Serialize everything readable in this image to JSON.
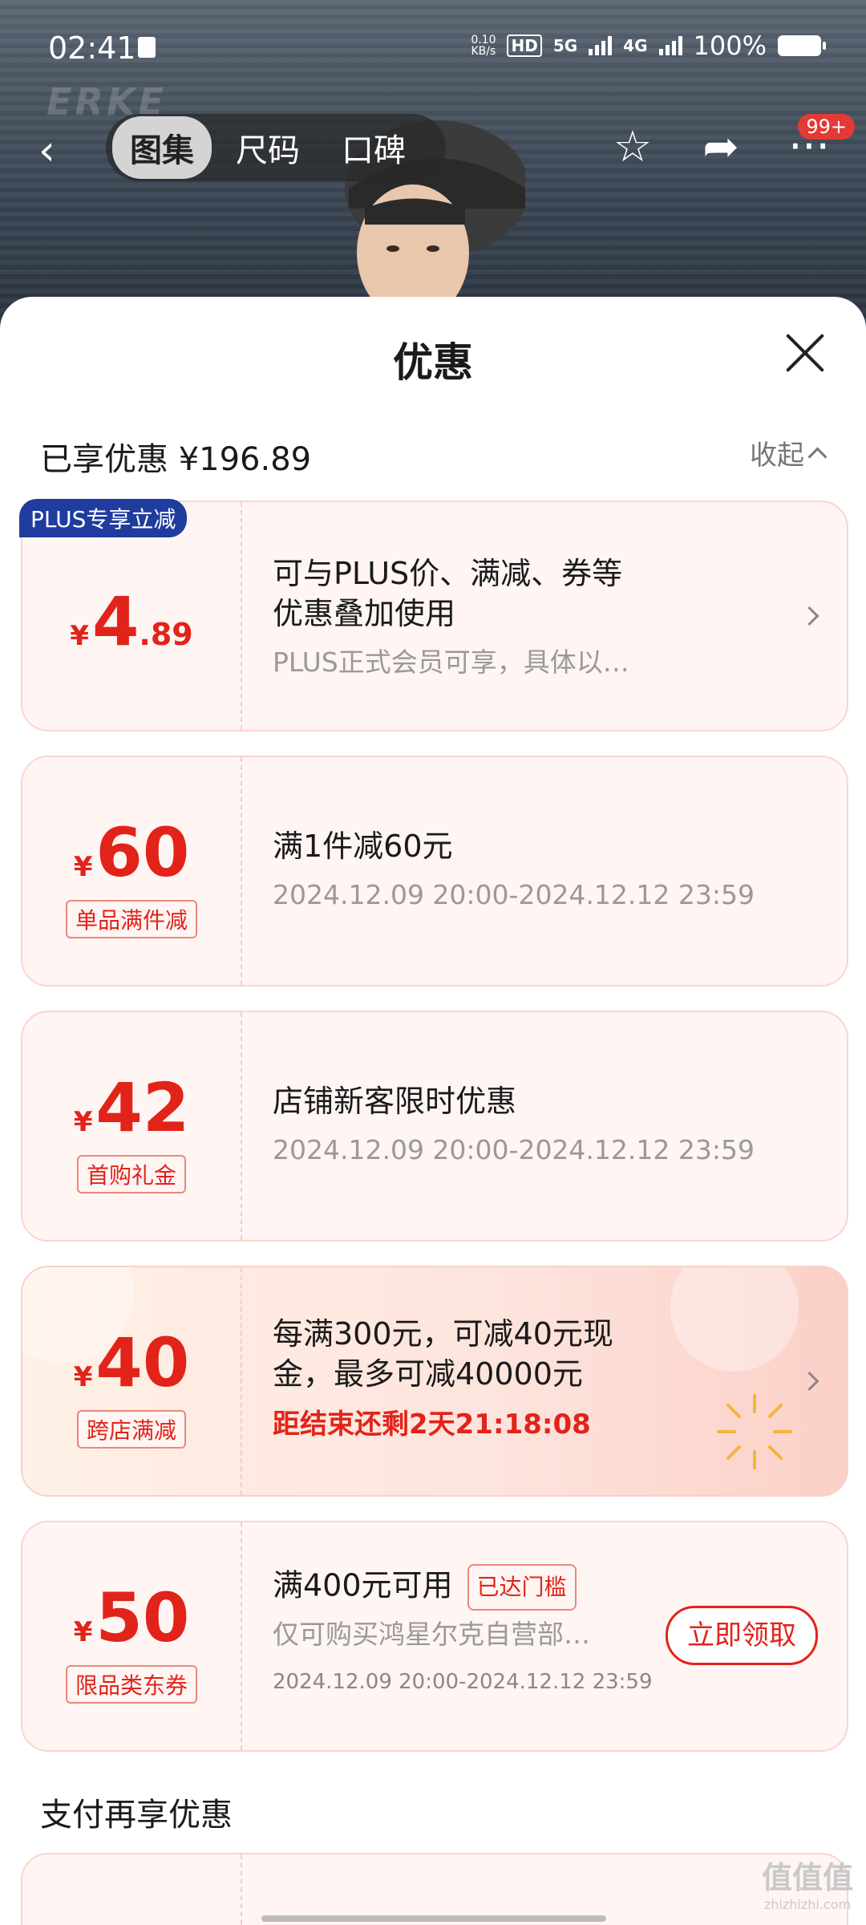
{
  "status": {
    "time": "02:41",
    "net_speed_top": "0.10",
    "net_speed_bottom": "KB/s",
    "hd": "HD",
    "sig1": "5G",
    "sig2": "4G",
    "battery": "100%"
  },
  "hero": {
    "brand": "ERKE"
  },
  "nav": {
    "back": "‹",
    "tabs": [
      "图集",
      "尺码",
      "口碑"
    ],
    "star": "☆",
    "share": "➦",
    "more": "···",
    "badge": "99+"
  },
  "sheet": {
    "title": "优惠",
    "summary": "已享优惠 ¥196.89",
    "collapse": "收起"
  },
  "cards": [
    {
      "badge": "PLUS专享立减",
      "currency": "¥",
      "amount": "4",
      "decimal": ".89",
      "title_line1": "可与PLUS价、满减、券等",
      "title_line2": "优惠叠加使用",
      "sub": "PLUS正式会员可享，具体以…"
    },
    {
      "currency": "¥",
      "amount": "60",
      "tag": "单品满件减",
      "title": "满1件减60元",
      "sub": "2024.12.09 20:00-2024.12.12 23:59"
    },
    {
      "currency": "¥",
      "amount": "42",
      "tag": "首购礼金",
      "title": "店铺新客限时优惠",
      "sub": "2024.12.09 20:00-2024.12.12 23:59"
    },
    {
      "currency": "¥",
      "amount": "40",
      "tag": "跨店满减",
      "title_line1": "每满300元，可减40元现",
      "title_line2": "金，最多可减40000元",
      "countdown": "距结束还剩2天21:18:08"
    },
    {
      "currency": "¥",
      "amount": "50",
      "tag": "限品类东券",
      "title": "满400元可用",
      "reached": "已达门槛",
      "sub": "仅可购买鸿星尔克自营部…",
      "date": "2024.12.09 20:00-2024.12.12 23:59",
      "button": "立即领取"
    }
  ],
  "pay_title": "支付再享优惠",
  "watermark": {
    "main": "值值值",
    "sub": "zhizhizhi.com"
  }
}
